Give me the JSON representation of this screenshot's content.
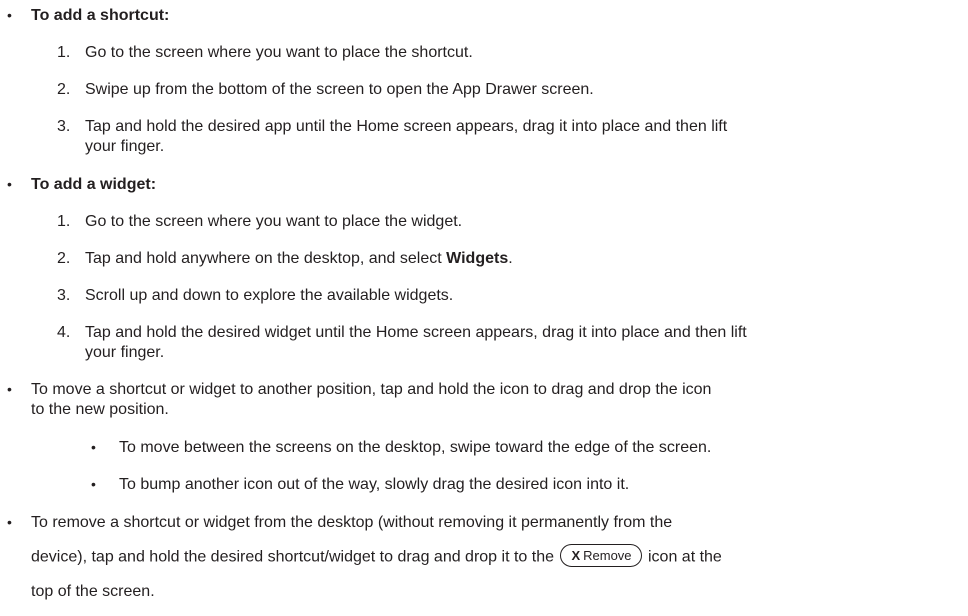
{
  "sections": {
    "shortcut": {
      "heading": "To add a shortcut:",
      "steps": [
        {
          "num": "1.",
          "text": "Go to the screen where you want to place the shortcut."
        },
        {
          "num": "2.",
          "text": "Swipe up from the bottom of the screen to open the App Drawer screen."
        },
        {
          "num": "3.",
          "line1": "Tap and hold the desired app until the Home screen appears, drag it into place and then lift",
          "line2": "your finger."
        }
      ]
    },
    "widget": {
      "heading": "To add a widget:",
      "steps": [
        {
          "num": "1.",
          "text": "Go to the screen where you want to place the widget."
        },
        {
          "num": "2.",
          "pre": "Tap and hold anywhere on the desktop, and select ",
          "bold": "Widgets",
          "post": "."
        },
        {
          "num": "3.",
          "text": "Scroll up and down to explore the available widgets."
        },
        {
          "num": "4.",
          "line1": "Tap and hold the desired widget until the Home screen appears, drag it into place and then lift",
          "line2": "your finger."
        }
      ]
    },
    "move": {
      "line1": "To move a shortcut or widget to another position, tap and hold the icon to drag and drop the icon",
      "line2": "to the new position.",
      "sub": [
        "To move between the screens on the desktop, swipe toward the edge of the screen.",
        "To bump another icon out of the way, slowly drag the desired icon into it."
      ]
    },
    "remove": {
      "line1": "To remove a shortcut or widget from the desktop (without removing it permanently from the",
      "line2_pre": "device), tap and hold the desired shortcut/widget to drag and drop it to the",
      "pill_x": "X",
      "pill_label": "Remove",
      "line2_post": "icon at the",
      "line3": "top of the screen."
    }
  },
  "bullet_glyph": "•"
}
